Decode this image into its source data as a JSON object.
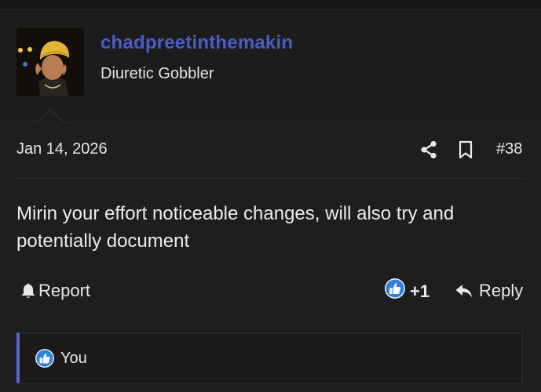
{
  "post": {
    "username": "chadpreetinthemakin",
    "user_title": "Diuretic Gobbler",
    "date": "Jan 14, 2026",
    "post_number": "#38",
    "message": "Mirin your effort noticeable changes, will also try and potentially document",
    "report_label": "Report",
    "like_count": "+1",
    "reply_label": "Reply",
    "reactions_label": "You"
  },
  "colors": {
    "username": "#4d5bc8",
    "like_badge": "#2d7fe0",
    "reactions_bar": "#5866d0",
    "background": "#1e1e1e"
  },
  "icons": {
    "share": "share-icon",
    "bookmark": "bookmark-icon",
    "report": "bell-icon",
    "like": "thumbs-up-icon",
    "reply": "reply-arrow-icon"
  }
}
